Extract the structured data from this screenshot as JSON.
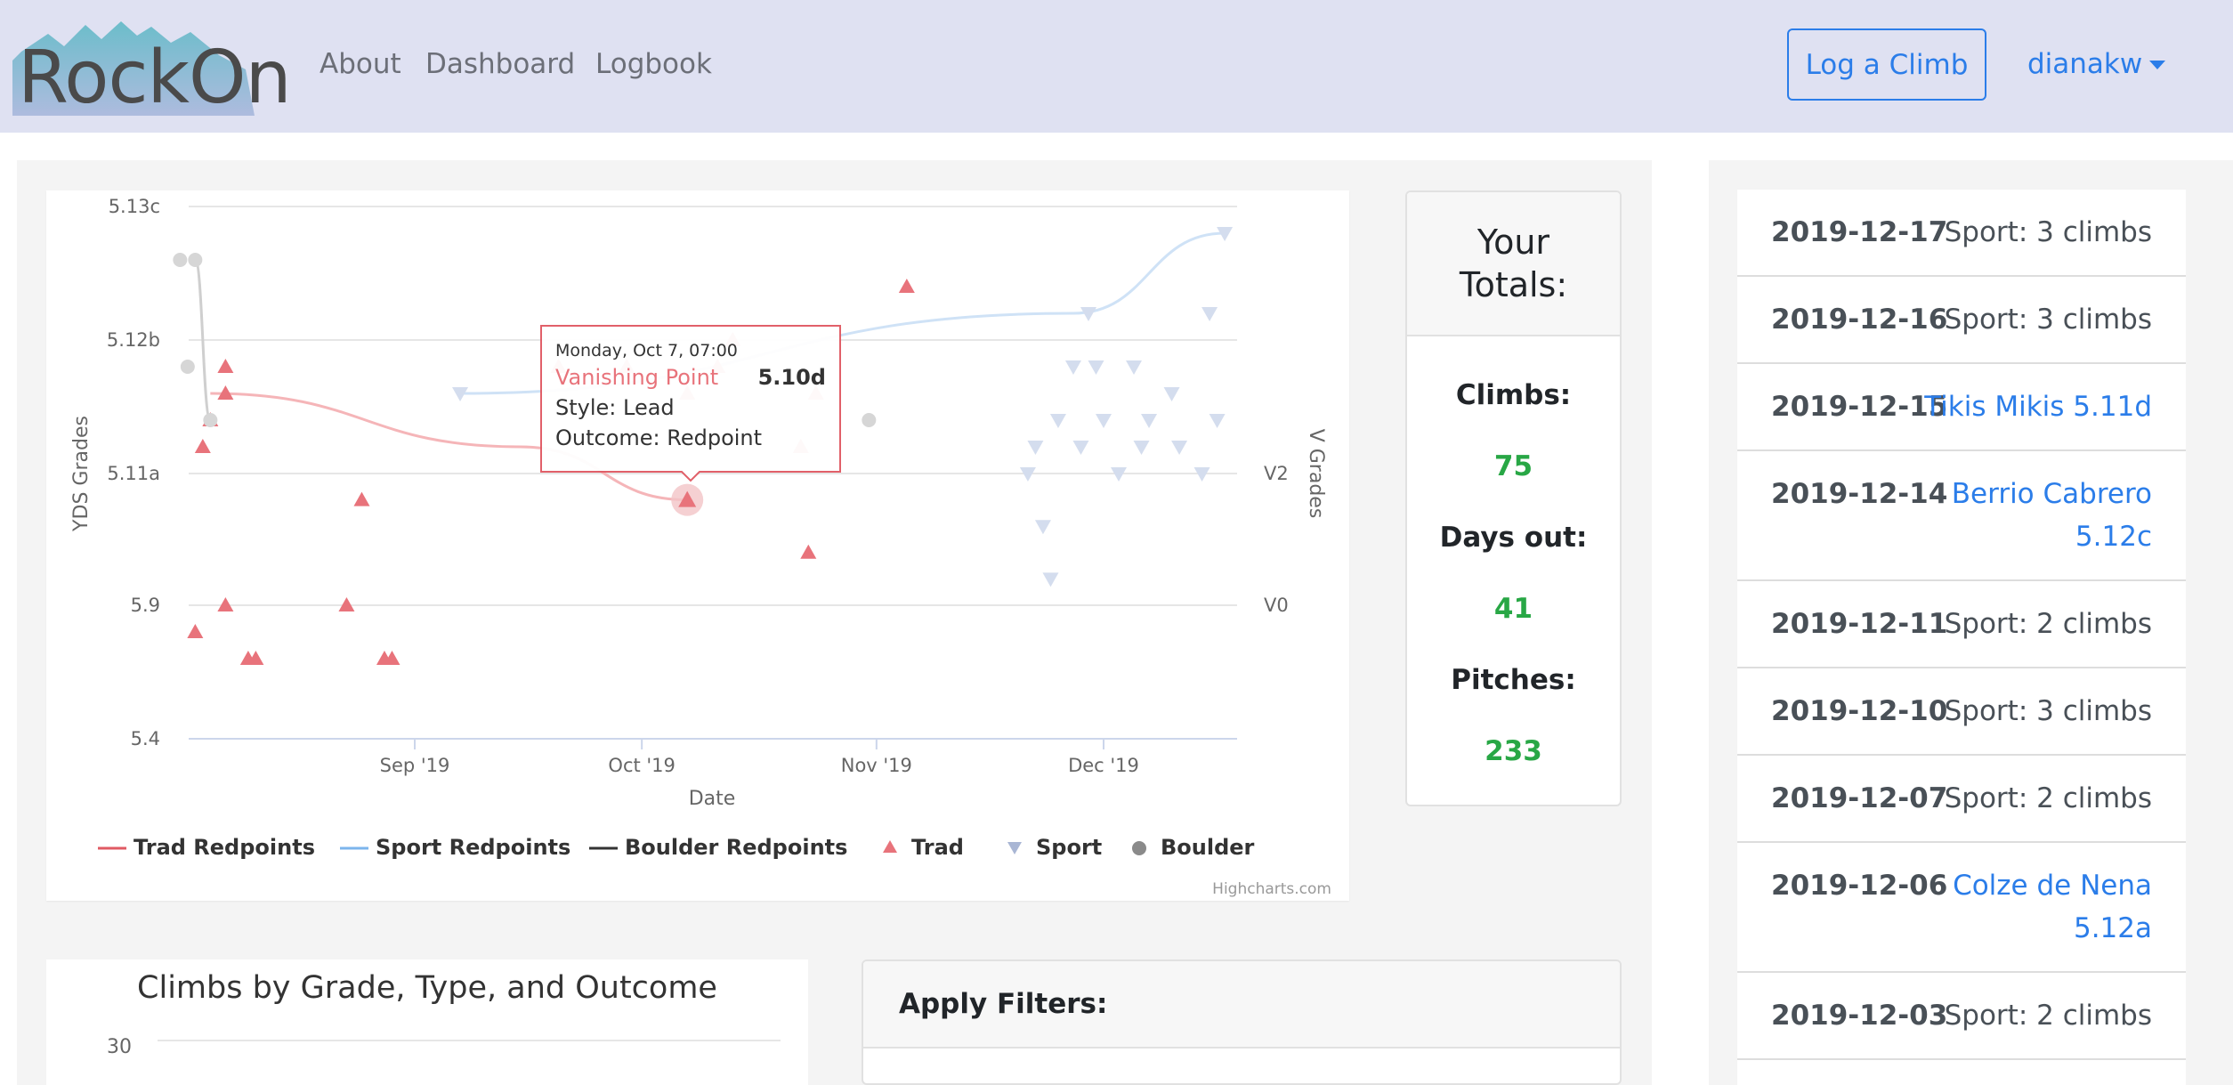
{
  "brand": {
    "name": "RockOn"
  },
  "nav": {
    "links": [
      "About",
      "Dashboard",
      "Logbook"
    ],
    "log_button": "Log a Climb",
    "user": "dianakw"
  },
  "chart_data": {
    "type": "scatter",
    "xlabel": "Date",
    "ylabel": "YDS Grades",
    "y2label": "V Grades",
    "y_ticks": [
      "5.13c",
      "5.12b",
      "5.11a",
      "5.9",
      "5.4"
    ],
    "y2_ticks": [
      "V2",
      "V0"
    ],
    "x_ticks": [
      "Sep '19",
      "Oct '19",
      "Nov '19",
      "Dec '19"
    ],
    "legend": [
      "Trad Redpoints",
      "Sport Redpoints",
      "Boulder Redpoints",
      "Trad",
      "Sport",
      "Boulder"
    ],
    "legend_position": "bottom",
    "credit": "Highcharts.com",
    "colors": {
      "trad": "#e8737b",
      "sport": "#a9b6d4",
      "boulder": "#8a8a8a",
      "trad_line": "#e05a63",
      "sport_line": "#7cb5ec",
      "boulder_line": "#333333"
    },
    "series": [
      {
        "name": "Trad",
        "symbol": "triangle",
        "points": [
          {
            "x": "2019-08-03",
            "y": "5.8"
          },
          {
            "x": "2019-08-04",
            "y": "5.11b"
          },
          {
            "x": "2019-08-05",
            "y": "5.11c"
          },
          {
            "x": "2019-08-07",
            "y": "5.12a"
          },
          {
            "x": "2019-08-07",
            "y": "5.9"
          },
          {
            "x": "2019-08-07",
            "y": "5.11d"
          },
          {
            "x": "2019-08-10",
            "y": "5.7"
          },
          {
            "x": "2019-08-11",
            "y": "5.7"
          },
          {
            "x": "2019-08-23",
            "y": "5.9"
          },
          {
            "x": "2019-08-25",
            "y": "5.10d"
          },
          {
            "x": "2019-08-28",
            "y": "5.7"
          },
          {
            "x": "2019-08-29",
            "y": "5.7"
          },
          {
            "x": "2019-09-20",
            "y": "5.12a"
          },
          {
            "x": "2019-09-29",
            "y": "5.12a"
          },
          {
            "x": "2019-10-07",
            "y": "5.10d"
          },
          {
            "x": "2019-10-07",
            "y": "5.11d"
          },
          {
            "x": "2019-10-11",
            "y": "5.12a"
          },
          {
            "x": "2019-10-13",
            "y": "5.12b"
          },
          {
            "x": "2019-10-22",
            "y": "5.11b"
          },
          {
            "x": "2019-10-23",
            "y": "5.10b"
          },
          {
            "x": "2019-10-24",
            "y": "5.11d"
          },
          {
            "x": "2019-11-05",
            "y": "5.12d"
          }
        ]
      },
      {
        "name": "Sport",
        "symbol": "triangle-down",
        "points": [
          {
            "x": "2019-09-07",
            "y": "5.11d"
          },
          {
            "x": "2019-11-21",
            "y": "5.11a"
          },
          {
            "x": "2019-11-22",
            "y": "5.11b"
          },
          {
            "x": "2019-11-23",
            "y": "5.10c"
          },
          {
            "x": "2019-11-24",
            "y": "5.10a"
          },
          {
            "x": "2019-11-25",
            "y": "5.11c"
          },
          {
            "x": "2019-11-27",
            "y": "5.12a"
          },
          {
            "x": "2019-11-28",
            "y": "5.11b"
          },
          {
            "x": "2019-11-29",
            "y": "5.12c"
          },
          {
            "x": "2019-11-30",
            "y": "5.12a"
          },
          {
            "x": "2019-12-01",
            "y": "5.11c"
          },
          {
            "x": "2019-12-03",
            "y": "5.11a"
          },
          {
            "x": "2019-12-05",
            "y": "5.12a"
          },
          {
            "x": "2019-12-06",
            "y": "5.11b"
          },
          {
            "x": "2019-12-07",
            "y": "5.11c"
          },
          {
            "x": "2019-12-10",
            "y": "5.11d"
          },
          {
            "x": "2019-12-11",
            "y": "5.11b"
          },
          {
            "x": "2019-12-14",
            "y": "5.11a"
          },
          {
            "x": "2019-12-15",
            "y": "5.12c"
          },
          {
            "x": "2019-12-16",
            "y": "5.11c"
          },
          {
            "x": "2019-12-17",
            "y": "5.13b"
          }
        ]
      },
      {
        "name": "Boulder",
        "symbol": "circle",
        "points": [
          {
            "x": "2019-08-01",
            "y": "5.13a"
          },
          {
            "x": "2019-08-02",
            "y": "5.12a"
          },
          {
            "x": "2019-08-03",
            "y": "5.13a"
          },
          {
            "x": "2019-08-05",
            "y": "5.11c"
          },
          {
            "x": "2019-10-31",
            "y": "5.11c"
          }
        ]
      },
      {
        "name": "Trad Redpoints",
        "type": "line",
        "points": [
          {
            "x": "2019-08-05",
            "y": "5.11d"
          },
          {
            "x": "2019-09-15",
            "y": "5.11b"
          },
          {
            "x": "2019-10-07",
            "y": "5.10d"
          }
        ]
      },
      {
        "name": "Sport Redpoints",
        "type": "line",
        "points": [
          {
            "x": "2019-09-07",
            "y": "5.11d"
          },
          {
            "x": "2019-11-27",
            "y": "5.12c"
          },
          {
            "x": "2019-12-17",
            "y": "5.13b"
          }
        ]
      },
      {
        "name": "Boulder Redpoints",
        "type": "line",
        "points": [
          {
            "x": "2019-08-03",
            "y": "5.13a"
          },
          {
            "x": "2019-08-05",
            "y": "5.11c"
          }
        ]
      }
    ],
    "tooltip": {
      "date": "Monday, Oct 7, 07:00",
      "name": "Vanishing Point",
      "grade": "5.10d",
      "style": "Style: Lead",
      "outcome": "Outcome: Redpoint"
    }
  },
  "totals": {
    "title_line1": "Your",
    "title_line2": "Totals:",
    "climbs_label": "Climbs:",
    "climbs": "75",
    "days_label": "Days out:",
    "days": "41",
    "pitches_label": "Pitches:",
    "pitches": "233"
  },
  "grade_chart": {
    "title": "Climbs by Grade, Type, and Outcome",
    "top_tick": "30"
  },
  "filters": {
    "title": "Apply Filters:"
  },
  "logbook": [
    {
      "date": "2019-12-17",
      "text": "Sport: 3 climbs",
      "link": false
    },
    {
      "date": "2019-12-16",
      "text": "Sport: 3 climbs",
      "link": false
    },
    {
      "date": "2019-12-15",
      "text": "Tikis Mikis 5.11d",
      "link": true
    },
    {
      "date": "2019-12-14",
      "text_line1": "Berrio Cabrero",
      "text_line2": "5.12c",
      "link": true
    },
    {
      "date": "2019-12-11",
      "text": "Sport: 2 climbs",
      "link": false
    },
    {
      "date": "2019-12-10",
      "text": "Sport: 3 climbs",
      "link": false
    },
    {
      "date": "2019-12-07",
      "text": "Sport: 2 climbs",
      "link": false
    },
    {
      "date": "2019-12-06",
      "text_line1": "Colze de Nena",
      "text_line2": "5.12a",
      "link": true
    },
    {
      "date": "2019-12-03",
      "text": "Sport: 2 climbs",
      "link": false
    }
  ]
}
